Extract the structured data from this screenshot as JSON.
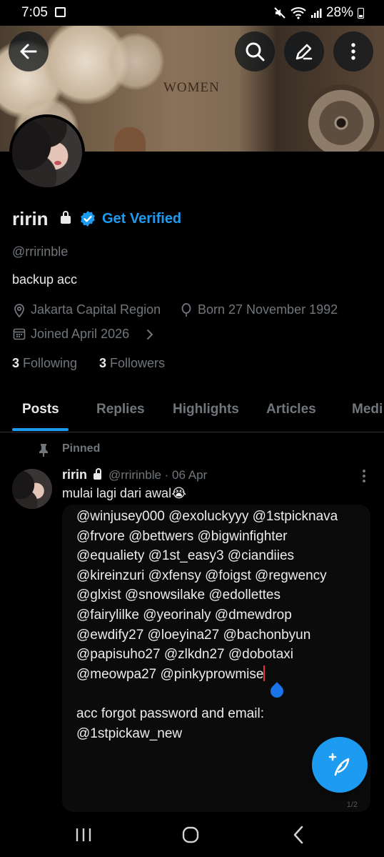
{
  "status_bar": {
    "time": "7:05",
    "battery": "28%"
  },
  "banner": {
    "word": "WOMEN"
  },
  "profile": {
    "name": "ririn",
    "get_verified": "Get Verified",
    "handle": "@rririnble",
    "bio": "backup acc",
    "location": "Jakarta Capital Region",
    "born": "Born 27 November 1992",
    "joined": "Joined April 2026",
    "following_count": "3",
    "following_label": "Following",
    "followers_count": "3",
    "followers_label": "Followers"
  },
  "tabs": [
    {
      "label": "Posts",
      "active": true
    },
    {
      "label": "Replies"
    },
    {
      "label": "Highlights"
    },
    {
      "label": "Articles"
    },
    {
      "label": "Medi"
    }
  ],
  "post": {
    "pinned_label": "Pinned",
    "author": "ririn",
    "handle_date": "@rririnble · 06 Apr",
    "text": "mulai lagi dari awal😭",
    "media_lines": [
      "@winjusey000 @exoluckyyy @1stpicknava",
      "@frvore @bettwers @bigwinfighter",
      "@equaliety @1st_easy3 @ciandiies",
      "@kireinzuri @xfensy @foigst @regwency",
      "@glxist @snowsilake @edollettes",
      "@fairylilke @yeorinaly @dmewdrop",
      "@ewdify27 @loeyina27 @bachonbyun",
      "@papisuho27 @zlkdn27 @dobotaxi",
      "@meowpa27 @pinkyprowmise",
      "",
      "acc forgot password and email:",
      "@1stpickaw_new"
    ],
    "media_counter": "1/2"
  },
  "icons": {
    "back": "arrow-left-icon",
    "search": "search-icon",
    "edit": "pencil-icon",
    "more": "more-vertical-icon",
    "compose": "compose-icon",
    "verified": "verified-badge-icon"
  },
  "colors": {
    "accent": "#1d9bf0",
    "background": "#000000",
    "secondary_text": "#71767b"
  }
}
